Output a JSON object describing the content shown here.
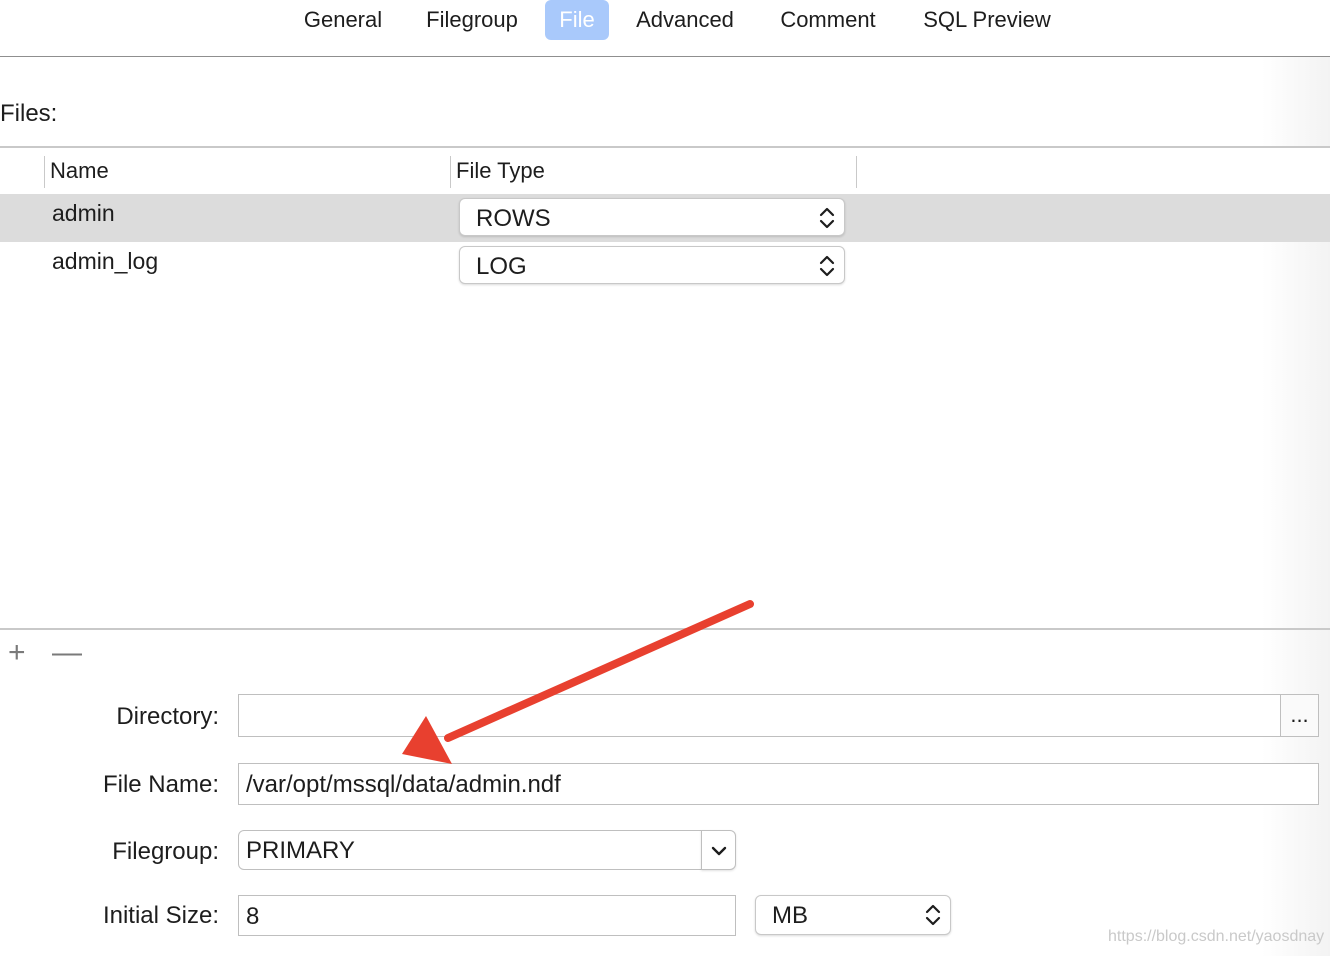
{
  "tabs": [
    {
      "label": "General",
      "active": false
    },
    {
      "label": "Filegroup",
      "active": false
    },
    {
      "label": "File",
      "active": true
    },
    {
      "label": "Advanced",
      "active": false
    },
    {
      "label": "Comment",
      "active": false
    },
    {
      "label": "SQL Preview",
      "active": false
    }
  ],
  "files_label": "Files:",
  "table": {
    "headers": [
      "Name",
      "File Type"
    ],
    "rows": [
      {
        "name": "admin",
        "file_type": "ROWS",
        "selected": true
      },
      {
        "name": "admin_log",
        "file_type": "LOG",
        "selected": false
      }
    ]
  },
  "toolbar": {
    "add_label": "+",
    "remove_label": "—"
  },
  "form": {
    "directory_label": "Directory:",
    "directory_value": "",
    "browse_label": "...",
    "file_name_label": "File Name:",
    "file_name_value": "/var/opt/mssql/data/admin.ndf",
    "filegroup_label": "Filegroup:",
    "filegroup_value": "PRIMARY",
    "initial_size_label": "Initial Size:",
    "initial_size_value": "8",
    "size_unit": "MB"
  },
  "watermark": "https://blog.csdn.net/yaosdnay",
  "colors": {
    "active_tab": "#a9c9fb",
    "selected_row": "#dcdcdc",
    "annotation_arrow": "#e8402f"
  }
}
